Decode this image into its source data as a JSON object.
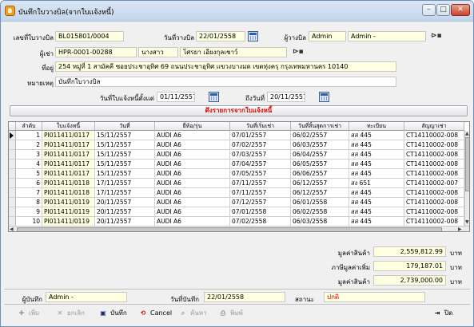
{
  "window": {
    "title": "บันทึกใบวางบิล(จากใบแจ้งหนี้)",
    "minimize": "–",
    "maximize": "□",
    "close": "✕",
    "app_icon": "฿"
  },
  "form": {
    "bill_no_label": "เลขที่ใบวางบิล",
    "bill_no": "BL015801/0004",
    "bill_date_label": "วันที่วางบิล",
    "bill_date": "22/01/2558",
    "biller_label": "ผู้วางบิล",
    "biller_code": "Admin",
    "biller_name": "Admin -",
    "renter_label": "ผู้เช่า",
    "renter_code": "HPR-0001-00288",
    "renter_title": "นางสาว",
    "renter_name": "โศรยา เอียงกุลเชาว์",
    "address_label": "ที่อยู่",
    "address": "254 หมู่ที่ 1 สามัคคี ซอยประชาอุทิศ 69 ถนนประชาอุทิศ แขวงบางมด เขตทุ่งครุ กรุงเทพมหานคร 10140",
    "remark_label": "หมายเหตุ",
    "remark": "บันทึกใบวางบิล",
    "from_label": "วันที่ใบแจ้งหนี้ตั้งแต่",
    "from_date": "01/11/2557",
    "to_label": "ถึงวันที่",
    "to_date": "20/11/2557",
    "fetch_button": "ดึงรายการจากใบแจ้งหนี้"
  },
  "grid": {
    "columns": [
      "ลำดับ",
      "ใบแจ้งหนี้",
      "วันที่",
      "ยี่ห้อ/รุ่น",
      "วันที่เริ่มเช่า",
      "วันที่สิ้นสุดการเช่า",
      "ทะเบียน",
      "สัญญาเช่า"
    ],
    "rows": [
      [
        "1",
        "PI011411/0117",
        "15/11/2557",
        "AUDI A6",
        "07/01/2557",
        "06/02/2557",
        "สส 445",
        "CT14110002-008"
      ],
      [
        "2",
        "PI011411/0117",
        "15/11/2557",
        "AUDI A6",
        "07/02/2557",
        "06/03/2557",
        "สส 445",
        "CT14110002-008"
      ],
      [
        "3",
        "PI011411/0117",
        "15/11/2557",
        "AUDI A6",
        "07/03/2557",
        "06/04/2557",
        "สส 445",
        "CT14110002-008"
      ],
      [
        "4",
        "PI011411/0117",
        "15/11/2557",
        "AUDI A6",
        "07/04/2557",
        "06/05/2557",
        "สส 445",
        "CT14110002-008"
      ],
      [
        "5",
        "PI011411/0117",
        "15/11/2557",
        "AUDI A6",
        "07/05/2557",
        "06/06/2557",
        "สส 445",
        "CT14110002-008"
      ],
      [
        "6",
        "PI011411/0118",
        "17/11/2557",
        "AUDI A6",
        "07/11/2557",
        "06/12/2557",
        "สง 651",
        "CT14110002-007"
      ],
      [
        "7",
        "PI011411/0118",
        "17/11/2557",
        "AUDI A6",
        "07/11/2557",
        "06/12/2557",
        "สส 445",
        "CT14110002-008"
      ],
      [
        "8",
        "PI011411/0119",
        "20/11/2557",
        "AUDI A6",
        "07/12/2557",
        "06/01/2558",
        "สส 445",
        "CT14110002-008"
      ],
      [
        "9",
        "PI011411/0119",
        "20/11/2557",
        "AUDI A6",
        "07/01/2558",
        "06/02/2558",
        "สส 445",
        "CT14110002-008"
      ],
      [
        "10",
        "PI011411/0119",
        "20/11/2557",
        "AUDI A6",
        "07/02/2558",
        "06/03/2558",
        "สส 445",
        "CT14110002-008"
      ]
    ]
  },
  "summary": {
    "subtotal_label": "มูลค่าสินค้า",
    "subtotal": "2,559,812.99",
    "vat_label": "ภาษีมูลค่าเพิ่ม",
    "vat": "179,187.01",
    "total_label": "มูลค่าสินค้า",
    "total": "2,739,000.00",
    "unit": "บาท"
  },
  "footer": {
    "recorder_label": "ผู้บันทึก",
    "recorder": "Admin -",
    "record_date_label": "วันที่บันทึก",
    "record_date": "22/01/2558",
    "status_label": "สถานะ",
    "status": "ปกติ",
    "status_color": "#e00000"
  },
  "toolbar": {
    "add": "เพิ่ม",
    "cancel_doc": "ยกเลิก",
    "save": "บันทึก",
    "cancel": "Cancel",
    "search": "ค้นหา",
    "print": "พิมพ์",
    "close": "ปิด"
  }
}
